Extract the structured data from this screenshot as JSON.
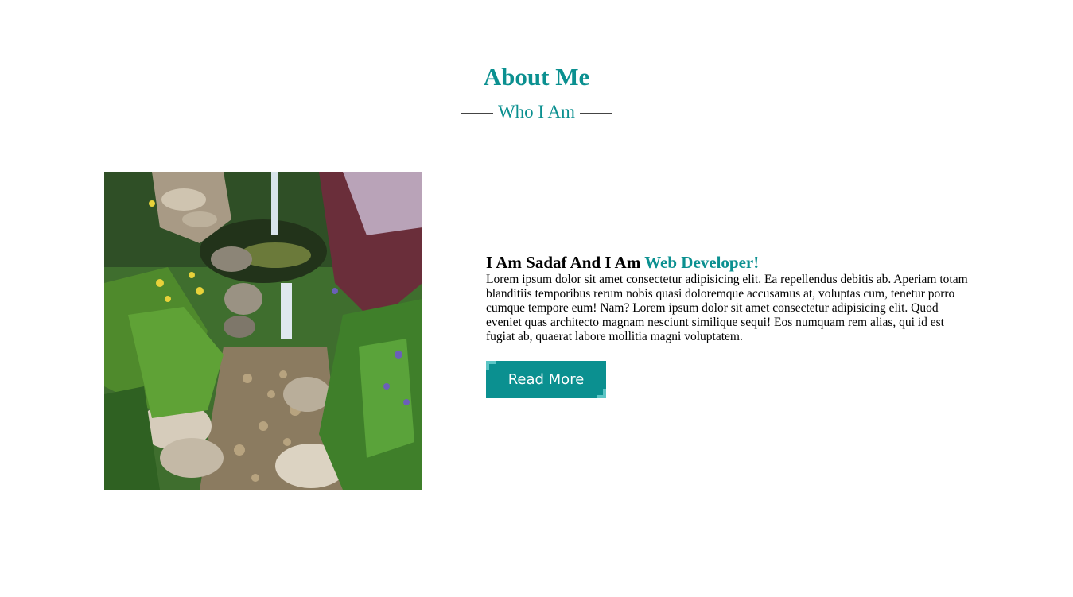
{
  "about": {
    "title": "About Me",
    "subtitle": "Who I Am"
  },
  "intro": {
    "heading_prefix": "I Am Sadaf And I Am ",
    "heading_accent": "Web Developer!",
    "body": "Lorem ipsum dolor sit amet consectetur adipisicing elit. Ea repellendus debitis ab. Aperiam totam blanditiis temporibus rerum nobis quasi doloremque accusamus at, voluptas cum, tenetur porro cumque tempore eum! Nam? Lorem ipsum dolor sit amet consectetur adipisicing elit. Quod eveniet quas architecto magnam nesciunt similique sequi! Eos numquam rem alias, qui id est fugiat ab, quaerat labore mollitia magni voluptatem.",
    "button_label": "Read More"
  },
  "colors": {
    "accent": "#0b9090",
    "accent_light": "#5cc5c5"
  }
}
